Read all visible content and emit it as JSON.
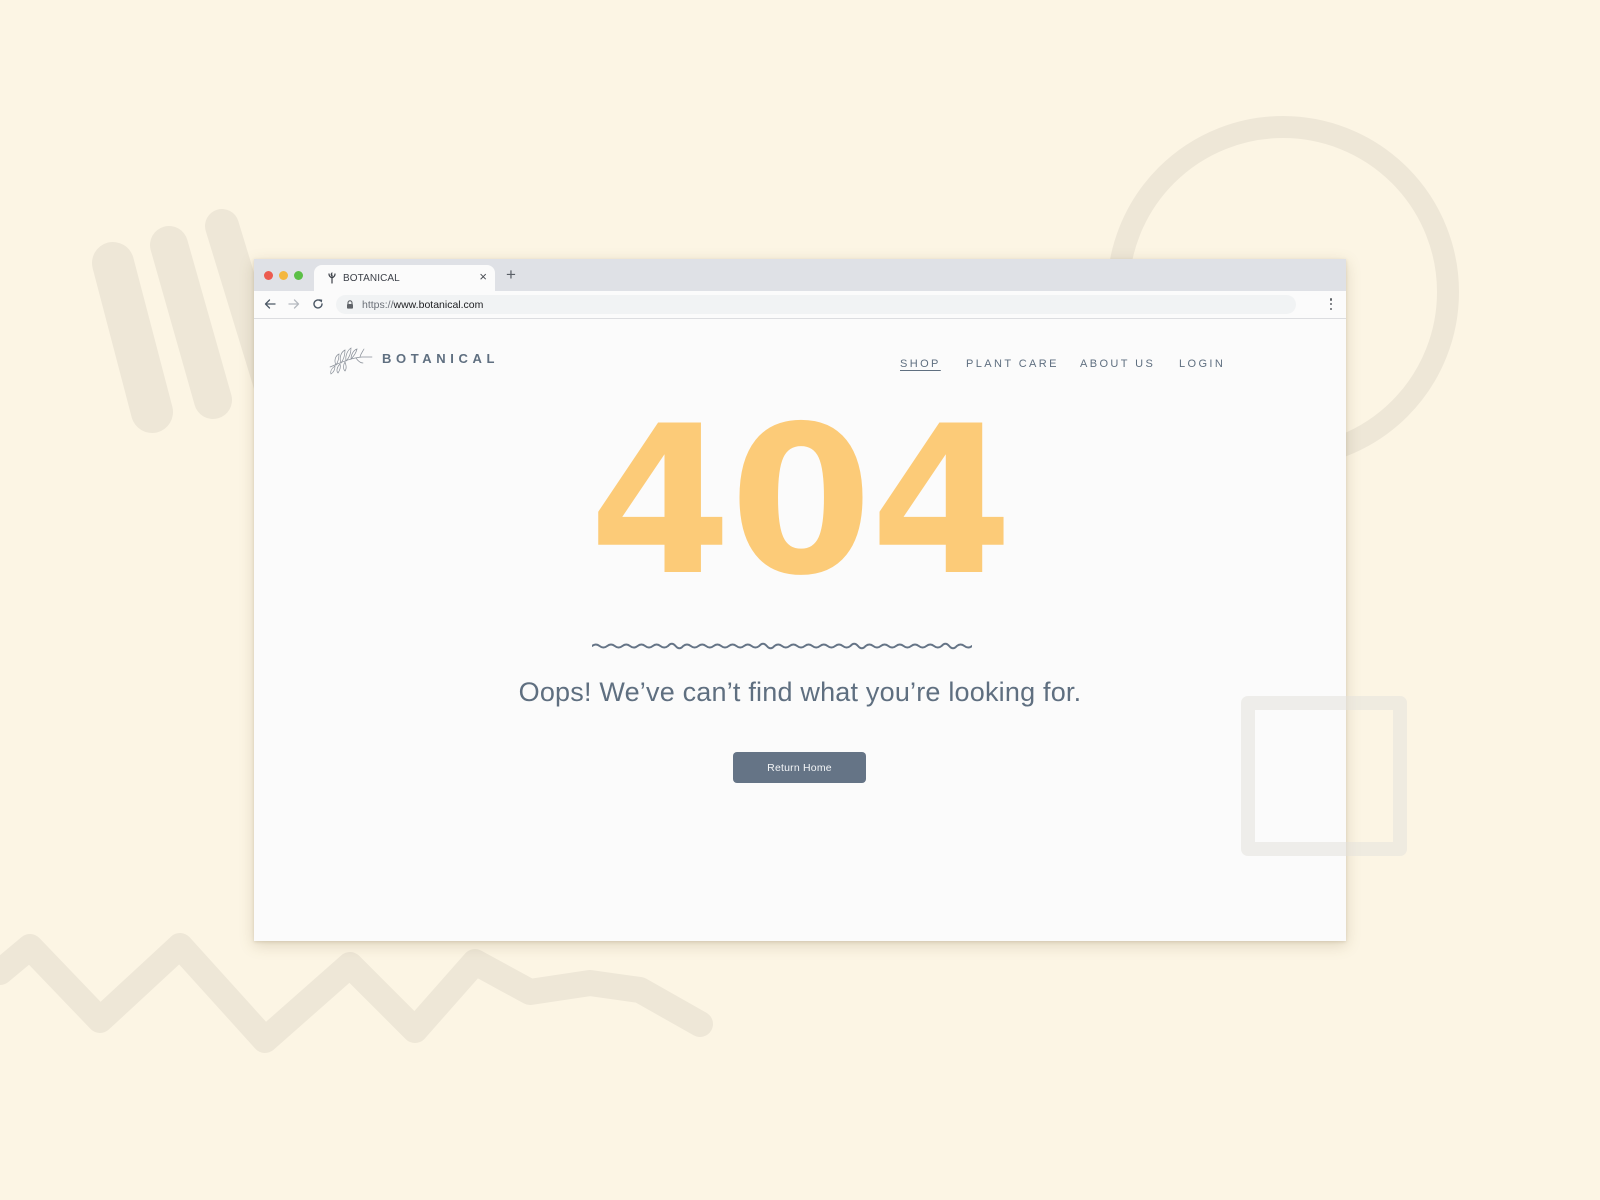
{
  "colors": {
    "background": "#fcf5e4",
    "accent_404": "#fccb78",
    "text_slate": "#5f6f80",
    "button_bg": "#657486"
  },
  "browser": {
    "tab": {
      "title": "BOTANICAL",
      "favicon": "plant-sprig-icon",
      "close_label": "×"
    },
    "new_tab_label": "+",
    "address": {
      "scheme": "https://",
      "host": "www.botanical.com"
    },
    "icons": {
      "back": "arrow-left-icon",
      "forward": "arrow-right-icon",
      "reload": "reload-icon",
      "lock": "lock-icon",
      "menu": "more-vertical-icon"
    }
  },
  "site": {
    "logo_text": "BOTANICAL",
    "logo_icon": "leaf-branch-icon",
    "nav": [
      {
        "label": "SHOP",
        "active": true
      },
      {
        "label": "PLANT CARE",
        "active": false
      },
      {
        "label": "ABOUT US",
        "active": false
      },
      {
        "label": "LOGIN",
        "active": false
      }
    ]
  },
  "error": {
    "code": "404",
    "message": "Oops! We’ve can’t find what you’re looking for.",
    "button_label": "Return Home"
  }
}
